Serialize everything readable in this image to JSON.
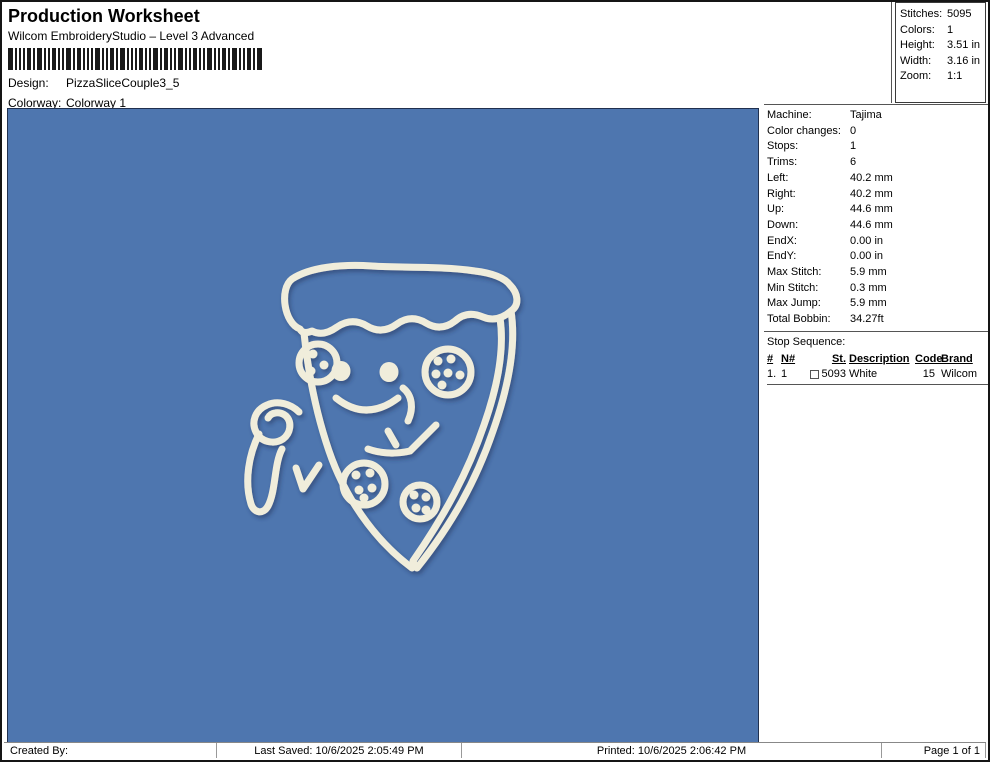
{
  "header": {
    "title": "Production Worksheet",
    "subtitle": "Wilcom EmbroideryStudio – Level 3 Advanced",
    "design_label": "Design:",
    "design_value": "PizzaSliceCouple3_5",
    "colorway_label": "Colorway:",
    "colorway_value": "Colorway 1",
    "barcode_bars": [
      5,
      2,
      2,
      2,
      4,
      2,
      5,
      2,
      2,
      4,
      2,
      2,
      5,
      2,
      4,
      2,
      2,
      2,
      5,
      2,
      2,
      4,
      2,
      5,
      2,
      2,
      2,
      4,
      2,
      2,
      5,
      2,
      4,
      2,
      2,
      5,
      2,
      2,
      4,
      2,
      2,
      5,
      2,
      2,
      4,
      2,
      5,
      2,
      2,
      4,
      2,
      5
    ]
  },
  "stats": {
    "rows": [
      {
        "label": "Stitches:",
        "value": "5095"
      },
      {
        "label": "Colors:",
        "value": "1"
      },
      {
        "label": "Height:",
        "value": "3.51 in"
      },
      {
        "label": "Width:",
        "value": "3.16 in"
      },
      {
        "label": "Zoom:",
        "value": "1:1"
      }
    ]
  },
  "machine_info": {
    "rows": [
      {
        "label": "Machine:",
        "value": "Tajima"
      },
      {
        "label": "Color changes:",
        "value": "0"
      },
      {
        "label": "Stops:",
        "value": "1"
      },
      {
        "label": "Trims:",
        "value": "6"
      },
      {
        "label": "Left:",
        "value": "40.2 mm"
      },
      {
        "label": "Right:",
        "value": "40.2 mm"
      },
      {
        "label": "Up:",
        "value": "44.6 mm"
      },
      {
        "label": "Down:",
        "value": "44.6 mm"
      },
      {
        "label": "EndX:",
        "value": "0.00 in"
      },
      {
        "label": "EndY:",
        "value": "0.00 in"
      },
      {
        "label": "Max Stitch:",
        "value": "5.9 mm"
      },
      {
        "label": "Min Stitch:",
        "value": "0.3 mm"
      },
      {
        "label": "Max Jump:",
        "value": "5.9 mm"
      },
      {
        "label": "Total Bobbin:",
        "value": "34.27ft"
      }
    ]
  },
  "stop_sequence": {
    "title": "Stop Sequence:",
    "columns": {
      "num": "#",
      "n": "N#",
      "st": "St.",
      "description": "Description",
      "code": "Code",
      "brand": "Brand"
    },
    "rows": [
      {
        "num": "1.",
        "n": "1",
        "st": "5093",
        "description": "White",
        "code": "15",
        "brand": "Wilcom"
      }
    ]
  },
  "canvas": {
    "design_name": "pizza-slice-character",
    "background": "#4E76AF",
    "thread_color": "#F0EDDB",
    "shadow_color": "#1c2f5a"
  },
  "footer": {
    "created_by": "Created By:",
    "last_saved": "Last Saved: 10/6/2025 2:05:49 PM",
    "printed": "Printed: 10/6/2025 2:06:42 PM",
    "page": "Page 1 of 1"
  }
}
